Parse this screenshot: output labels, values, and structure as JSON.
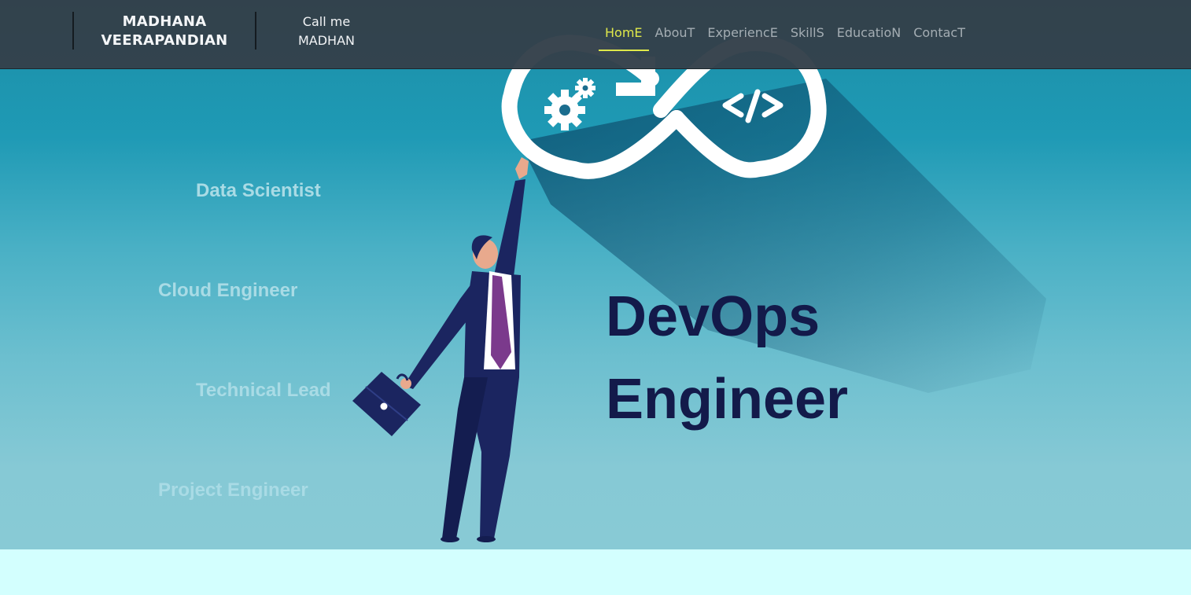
{
  "brand": {
    "line1": "MADHANA",
    "line2": "VEERAPANDIAN"
  },
  "callme": {
    "line1": "Call me",
    "line2": "MADHAN"
  },
  "nav": {
    "items": [
      {
        "label": "HomE",
        "active": true
      },
      {
        "label": "AbouT",
        "active": false
      },
      {
        "label": "ExperiencE",
        "active": false
      },
      {
        "label": "SkillS",
        "active": false
      },
      {
        "label": "EducatioN",
        "active": false
      },
      {
        "label": "ContacT",
        "active": false
      }
    ]
  },
  "roles": [
    "Data Scientist",
    "Cloud Engineer",
    "Technical Lead",
    "Project Engineer"
  ],
  "headline": {
    "line1": "DevOps",
    "line2": "Engineer"
  },
  "hero_art": {
    "icons": [
      "gears-icon",
      "code-brackets-icon",
      "infinity-loop-icon",
      "arrow-icon"
    ],
    "illustration": "businessman-reaching-with-briefcase"
  },
  "colors": {
    "navbar": "#34404a",
    "nav_active": "#dfe84a",
    "nav_inactive": "#a4adb3",
    "headline": "#131a4a",
    "role_text": "#a9dbe5",
    "footer_strip": "#d3fffe",
    "hero_top": "#1b8ea7",
    "hero_bottom": "#88cad5"
  }
}
